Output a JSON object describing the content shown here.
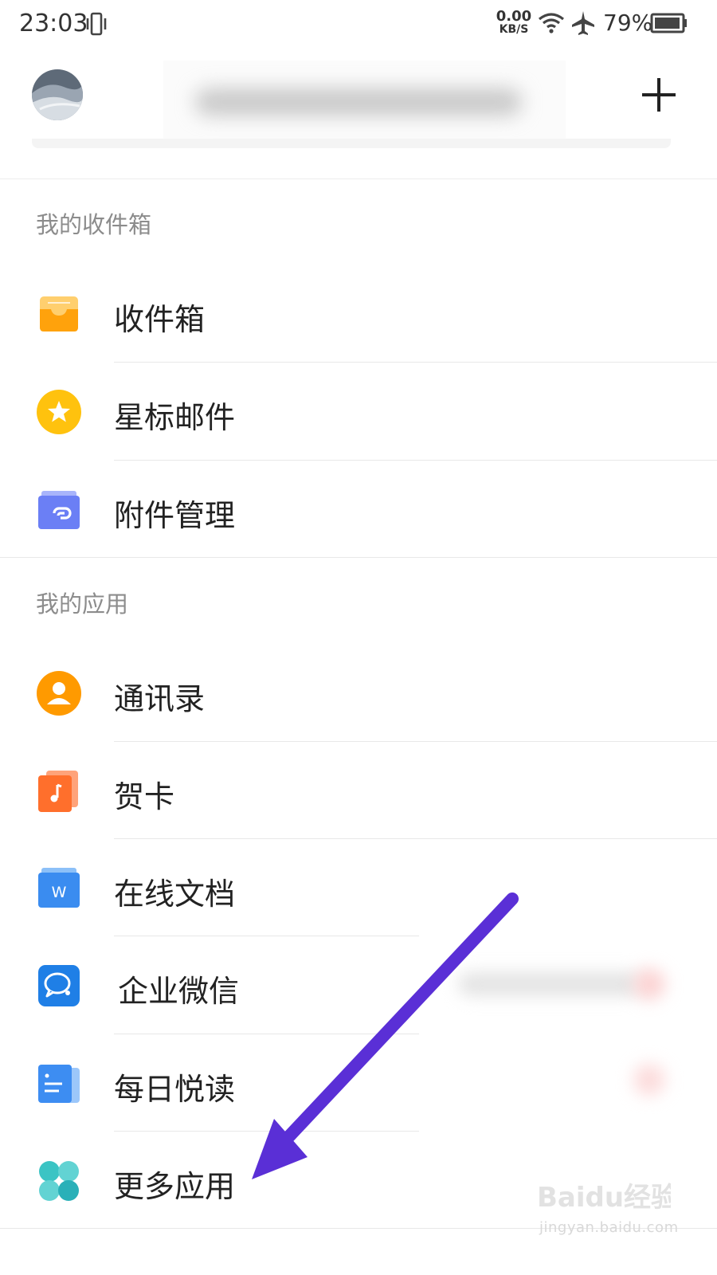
{
  "status_bar": {
    "time": "23:03",
    "net_speed_value": "0.00",
    "net_speed_unit": "KB/S",
    "battery": "79%"
  },
  "header": {
    "avatar_icon": "avatar",
    "add_icon": "plus-icon"
  },
  "sections": {
    "inbox_title": "我的收件箱",
    "apps_title": "我的应用"
  },
  "inbox_items": [
    {
      "label": "收件箱",
      "icon": "inbox-tray-icon",
      "color": "#ffa20c"
    },
    {
      "label": "星标邮件",
      "icon": "star-icon",
      "color": "#ffc107"
    },
    {
      "label": "附件管理",
      "icon": "attachment-icon",
      "color": "#6b7ff5"
    }
  ],
  "app_items": [
    {
      "label": "通讯录",
      "icon": "contacts-icon",
      "color": "#ff9a00"
    },
    {
      "label": "贺卡",
      "icon": "greeting-card-icon",
      "color": "#ff6f2c"
    },
    {
      "label": "在线文档",
      "icon": "word-doc-icon",
      "color": "#3a8cf0"
    },
    {
      "label": "企业微信",
      "icon": "wecom-icon",
      "color": "#1f7fe6"
    },
    {
      "label": "每日悦读",
      "icon": "daily-read-icon",
      "color": "#3d8df2"
    },
    {
      "label": "更多应用",
      "icon": "more-apps-icon",
      "color": "#3bc4c4"
    }
  ],
  "annotation": {
    "arrow_color": "#5a2fd6"
  },
  "watermark": {
    "brand": "Baidu经验",
    "url": "jingyan.baidu.com"
  }
}
